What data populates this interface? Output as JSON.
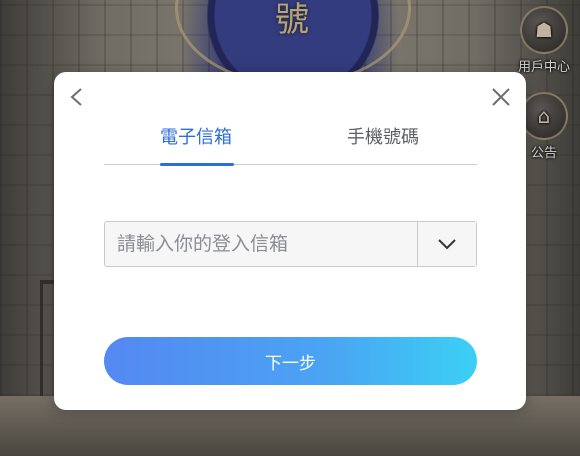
{
  "background": {
    "emblem_char": "號",
    "side_buttons": {
      "user_center": "用戶中心",
      "notice": "公告"
    }
  },
  "login_dialog": {
    "back_icon": "chevron-left-icon",
    "close_icon": "close-icon",
    "tabs": [
      {
        "label": "電子信箱",
        "active": true
      },
      {
        "label": "手機號碼",
        "active": false
      }
    ],
    "email_input": {
      "value": "",
      "placeholder": "請輸入你的登入信箱"
    },
    "domain_dropdown_icon": "chevron-down-icon",
    "next_button_label": "下一步"
  },
  "colors": {
    "accent": "#2d6fd8",
    "button_gradient_start": "#5488f2",
    "button_gradient_end": "#3bd0f5"
  }
}
